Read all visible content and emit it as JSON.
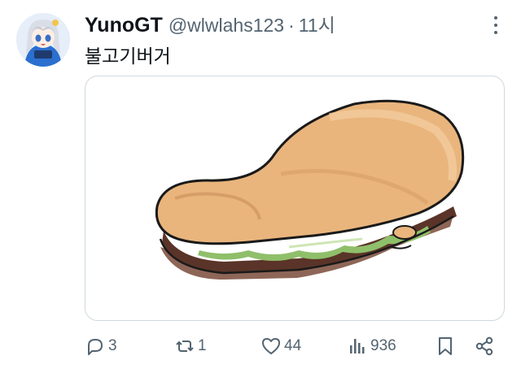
{
  "post": {
    "author_name": "YunoGT",
    "author_handle": "@wlwlahs123",
    "separator": "·",
    "time": "11시",
    "text": "불고기버거"
  },
  "actions": {
    "replies": "3",
    "reposts": "1",
    "likes": "44",
    "views": "936"
  },
  "icons": {
    "avatar": "anime-avatar",
    "more": "more-vertical-icon",
    "reply": "reply-icon",
    "repost": "repost-icon",
    "like": "heart-icon",
    "views": "views-bar-icon",
    "bookmark": "bookmark-icon",
    "share": "share-icon"
  },
  "colors": {
    "text_primary": "#0f1419",
    "text_secondary": "#536471",
    "border": "#cfd9de"
  }
}
